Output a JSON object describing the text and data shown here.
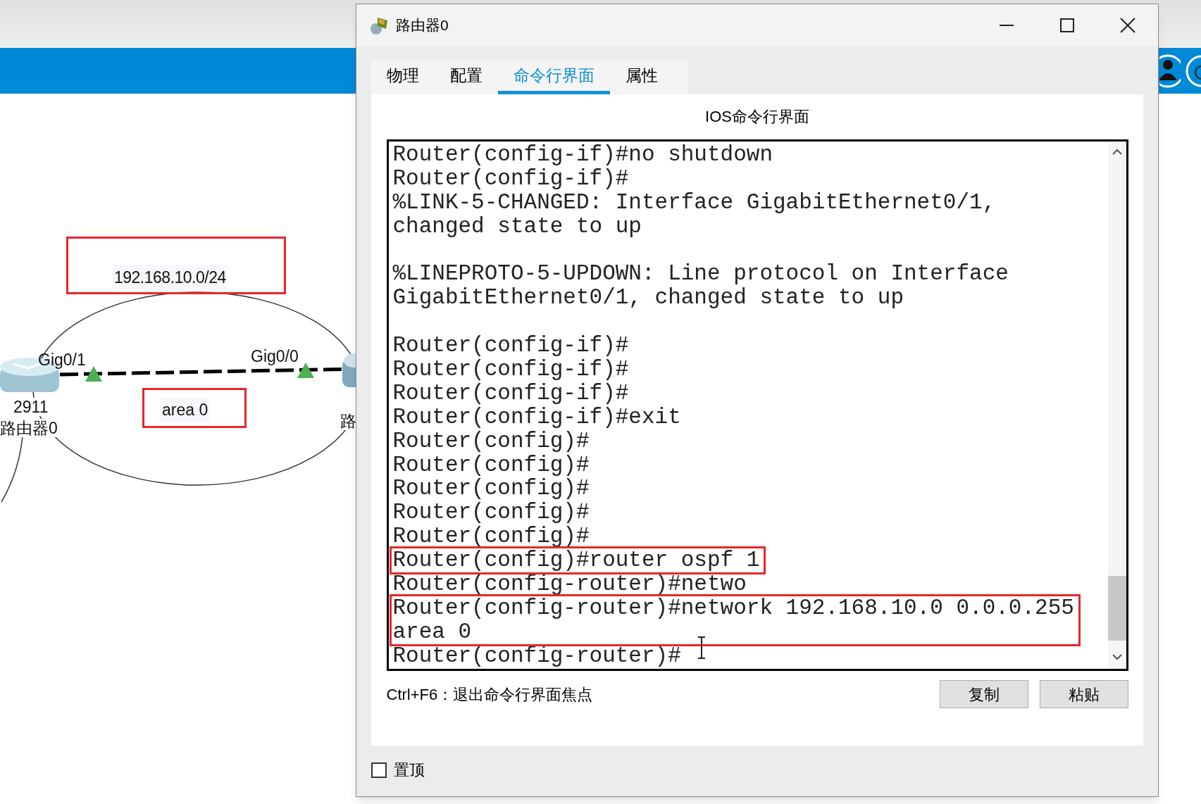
{
  "canvas": {
    "network_label": {
      "text": "192.168.10.0/24",
      "highlighted": true
    },
    "area_label": {
      "text": "area 0",
      "highlighted": true
    },
    "ports": [
      {
        "text": "Gig0/1"
      },
      {
        "text": "Gig0/0"
      }
    ],
    "left_router": {
      "model": "2911",
      "name": "路由器0"
    },
    "right_router": {
      "name": "路"
    }
  },
  "window": {
    "title": "路由器0",
    "tabs": [
      {
        "label": "物理",
        "selected": false
      },
      {
        "label": "配置",
        "selected": false
      },
      {
        "label": "命令行界面",
        "selected": true
      },
      {
        "label": "属性",
        "selected": false
      }
    ],
    "heading": "IOS命令行界面",
    "terminal": {
      "blocks": [
        {
          "lines": [
            {
              "text": "Router(config-if)#no shutdown",
              "highlighted": false
            },
            {
              "text": "Router(config-if)#",
              "highlighted": false
            },
            {
              "text": "%LINK-5-CHANGED: Interface GigabitEthernet0/1,",
              "highlighted": false
            },
            {
              "text": "changed state to up",
              "highlighted": false
            }
          ]
        },
        {
          "lines": [
            {
              "text": "%LINEPROTO-5-UPDOWN: Line protocol on Interface",
              "highlighted": false
            },
            {
              "text": "GigabitEthernet0/1, changed state to up",
              "highlighted": false
            }
          ]
        },
        {
          "lines": [
            {
              "text": "Router(config-if)#",
              "highlighted": false
            },
            {
              "text": "Router(config-if)#",
              "highlighted": false
            },
            {
              "text": "Router(config-if)#",
              "highlighted": false
            },
            {
              "text": "Router(config-if)#exit",
              "highlighted": false
            },
            {
              "text": "Router(config)#",
              "highlighted": false
            },
            {
              "text": "Router(config)#",
              "highlighted": false
            },
            {
              "text": "Router(config)#",
              "highlighted": false
            },
            {
              "text": "Router(config)#",
              "highlighted": false
            },
            {
              "text": "Router(config)#",
              "highlighted": false
            },
            {
              "text": "Router(config)#router ospf 1",
              "highlighted": true
            },
            {
              "text": "Router(config-router)#netwo",
              "highlighted": false
            },
            {
              "text": "Router(config-router)#network 192.168.10.0 0.0.0.255",
              "highlighted": true
            },
            {
              "text": "area 0",
              "highlighted": true
            },
            {
              "text": "Router(config-router)#",
              "highlighted": false
            }
          ]
        }
      ]
    },
    "hint": "Ctrl+F6：退出命令行界面焦点",
    "buttons": [
      "复制",
      "粘贴"
    ],
    "always_on_top": {
      "label": "置顶",
      "checked": false
    }
  }
}
